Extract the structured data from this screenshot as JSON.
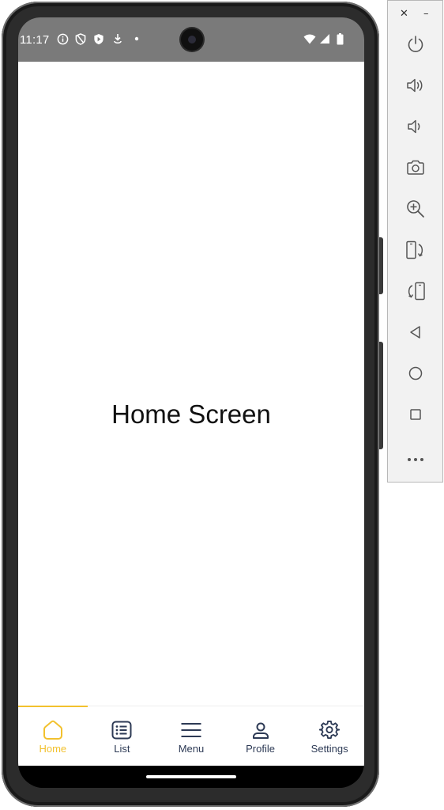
{
  "status_bar": {
    "time": "11:17",
    "background": "#7a7a7a",
    "left_icons": [
      "info-icon",
      "shield-icon",
      "vpn-shield-icon",
      "download-icon",
      "dot-icon"
    ],
    "right_icons": [
      "wifi-icon",
      "signal-icon",
      "battery-icon"
    ]
  },
  "main": {
    "text": "Home Screen"
  },
  "bottom_nav": {
    "active_color": "#f2c12e",
    "inactive_color": "#2d3a55",
    "items": [
      {
        "label": "Home",
        "icon": "home-icon",
        "active": true
      },
      {
        "label": "List",
        "icon": "list-icon",
        "active": false
      },
      {
        "label": "Menu",
        "icon": "menu-icon",
        "active": false
      },
      {
        "label": "Profile",
        "icon": "profile-icon",
        "active": false
      },
      {
        "label": "Settings",
        "icon": "settings-icon",
        "active": false
      }
    ]
  },
  "emulator_toolbar": {
    "close_label": "✕",
    "minimize_label": "–",
    "buttons": [
      {
        "icon": "power-icon"
      },
      {
        "icon": "volume-up-icon"
      },
      {
        "icon": "volume-down-icon"
      },
      {
        "icon": "camera-icon"
      },
      {
        "icon": "zoom-in-icon"
      },
      {
        "icon": "rotate-left-icon"
      },
      {
        "icon": "rotate-right-icon"
      },
      {
        "icon": "back-icon"
      },
      {
        "icon": "home-circle-icon"
      },
      {
        "icon": "overview-icon"
      },
      {
        "icon": "more-icon"
      }
    ]
  }
}
